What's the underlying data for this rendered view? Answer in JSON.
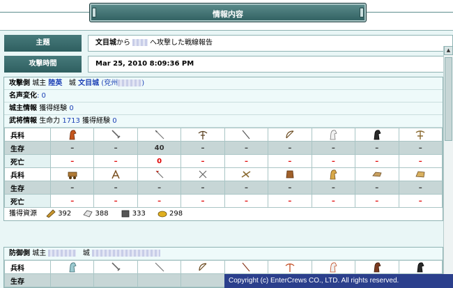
{
  "title": "情報内容",
  "header": {
    "subject_label": "主題",
    "subject_value_prefix": "文目城",
    "subject_value_mid": "から",
    "subject_value_suffix": "へ攻撃した戦線報告",
    "time_label": "攻撃時間",
    "time_value": "Mar 25, 2010 8:09:36 PM"
  },
  "attacker": {
    "side_label": "攻撃側",
    "lord_label": "城主",
    "lord_name": "陸英",
    "city_label": "城",
    "city_name": "文目城",
    "region_prefix": "(兗州",
    "region_suffix": ")",
    "fame_label": "名声変化",
    "fame_value": ": 0",
    "lord_info_label": "城主情報",
    "lord_info_text": "獲得経験",
    "lord_info_value": "0",
    "general_info_label": "武将情報",
    "general_life_text": "生命力",
    "general_life_value": "1713",
    "general_exp_text": "獲得経験",
    "general_exp_value": "0",
    "row1": {
      "type_label": "兵科",
      "alive_label": "生存",
      "dead_label": "死亡",
      "icons": [
        "horse-head-icon",
        "broadsword-icon",
        "spear-icon",
        "crossbow-icon",
        "pike-icon",
        "bow-icon",
        "white-horse-icon",
        "black-horse-icon",
        "heavy-crossbow-icon"
      ],
      "alive": [
        "–",
        "–",
        "40",
        "–",
        "–",
        "–",
        "–",
        "–",
        "–"
      ],
      "dead": [
        "–",
        "–",
        "0",
        "–",
        "–",
        "–",
        "–",
        "–",
        "–"
      ]
    },
    "row2": {
      "type_label": "兵科",
      "alive_label": "生存",
      "dead_label": "死亡",
      "icons": [
        "cart-icon",
        "catapult-icon",
        "halberd-icon",
        "swords-icon",
        "ballista-icon",
        "armor-icon",
        "gold-horse-icon",
        "chariot-icon",
        "war-wagon-icon"
      ],
      "alive": [
        "–",
        "–",
        "–",
        "–",
        "–",
        "–",
        "–",
        "–",
        "–"
      ],
      "dead": [
        "–",
        "–",
        "–",
        "–",
        "–",
        "–",
        "–",
        "–",
        "–"
      ]
    },
    "resources_label": "獲得資源",
    "resources": [
      {
        "icon": "lumber-icon",
        "value": "392"
      },
      {
        "icon": "clay-icon",
        "value": "388"
      },
      {
        "icon": "iron-icon",
        "value": "333"
      },
      {
        "icon": "grain-icon",
        "value": "298"
      }
    ]
  },
  "defender": {
    "side_label": "防御側",
    "lord_label": "城主",
    "city_label": "城",
    "type_label": "兵科",
    "alive_label": "生存",
    "icons": [
      "horse-head-icon",
      "broadsword-icon",
      "spear-icon",
      "bow-icon",
      "pike-icon",
      "crossbow-icon",
      "white-horse-icon",
      "brown-horse-icon",
      "black-horse-icon"
    ]
  },
  "copyright": "Copyright (c) EnterCrews CO., LTD. All rights reserved."
}
